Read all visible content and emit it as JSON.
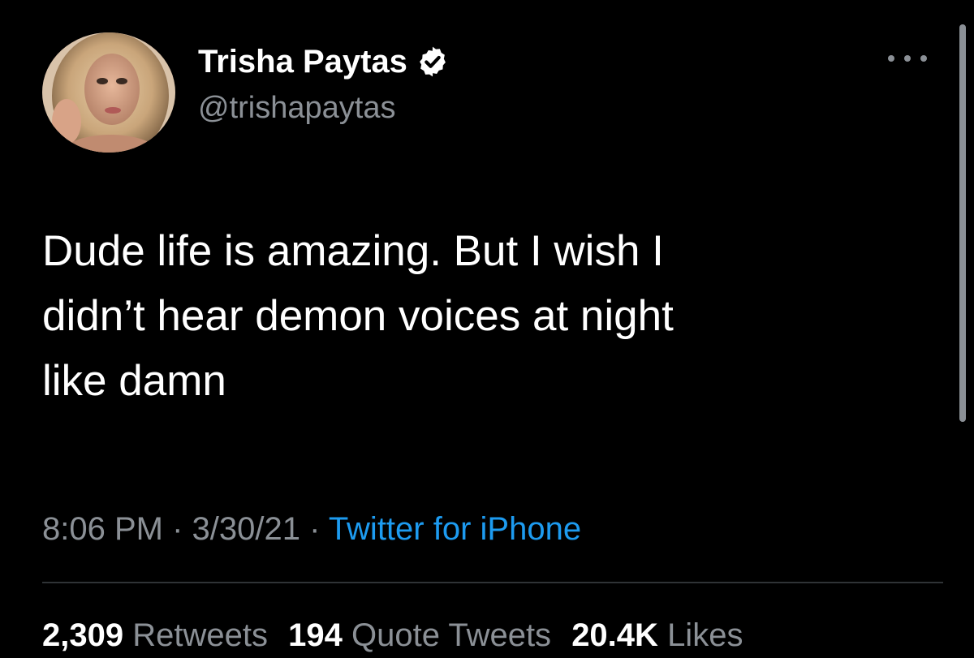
{
  "author": {
    "name": "Trisha Paytas",
    "handle": "@trishapaytas",
    "verified": true
  },
  "tweet": {
    "text": "Dude life is amazing. But I wish I\ndidn’t hear demon voices at night\nlike damn"
  },
  "meta": {
    "time": "8:06 PM",
    "separator1": " · ",
    "date": "3/30/21",
    "separator2": " · ",
    "source": "Twitter for iPhone"
  },
  "stats": {
    "retweets_count": "2,309",
    "retweets_label": "Retweets",
    "quotes_count": "194",
    "quotes_label": "Quote Tweets",
    "likes_count": "20.4K",
    "likes_label": "Likes"
  },
  "colors": {
    "background": "#000000",
    "primary_text": "#ffffff",
    "secondary_text": "#8b9096",
    "accent": "#1d9bf0",
    "divider": "#2f3336"
  },
  "icons": {
    "verified": "verified-badge-icon",
    "more": "more-options-icon"
  }
}
